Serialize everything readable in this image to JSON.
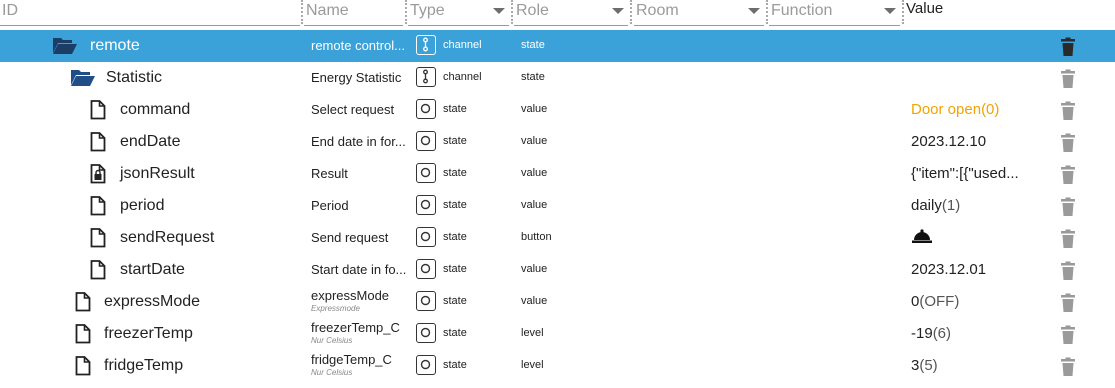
{
  "header": {
    "filters": [
      {
        "key": "id",
        "placeholder": "ID",
        "select": false
      },
      {
        "key": "name",
        "placeholder": "Name",
        "select": false
      },
      {
        "key": "type",
        "placeholder": "Type",
        "select": true
      },
      {
        "key": "role",
        "placeholder": "Role",
        "select": true
      },
      {
        "key": "room",
        "placeholder": "Room",
        "select": true
      },
      {
        "key": "function",
        "placeholder": "Function",
        "select": true
      }
    ],
    "value_label": "Value"
  },
  "rows": [
    {
      "id": "remote",
      "kind": "folder-open",
      "indent": 1,
      "name": "remote control...",
      "sub": "",
      "type_icon": "channel-icon",
      "type": "channel",
      "role": "state",
      "value": "",
      "state": "",
      "value_color": "",
      "selected": true
    },
    {
      "id": "Statistic",
      "kind": "folder-open",
      "indent": 2,
      "name": "Energy Statistic",
      "sub": "",
      "type_icon": "channel-icon",
      "type": "channel",
      "role": "state",
      "value": "",
      "state": "",
      "value_color": "",
      "selected": false
    },
    {
      "id": "command",
      "kind": "file",
      "indent": 3,
      "name": "Select request",
      "sub": "",
      "type_icon": "state-icon",
      "type": "state",
      "role": "value",
      "value": "Door open",
      "state": "(0)",
      "value_color": "#f0a400",
      "selected": false
    },
    {
      "id": "endDate",
      "kind": "file",
      "indent": 3,
      "name": "End date in for...",
      "sub": "",
      "type_icon": "state-icon",
      "type": "state",
      "role": "value",
      "value": "2023.12.10",
      "state": "",
      "value_color": "",
      "selected": false
    },
    {
      "id": "jsonResult",
      "kind": "file-lock",
      "indent": 3,
      "name": "Result",
      "sub": "",
      "type_icon": "state-icon",
      "type": "state",
      "role": "value",
      "value": "{\"item\":[{\"used...",
      "state": "",
      "value_color": "",
      "selected": false
    },
    {
      "id": "period",
      "kind": "file",
      "indent": 3,
      "name": "Period",
      "sub": "",
      "type_icon": "state-icon",
      "type": "state",
      "role": "value",
      "value": "daily",
      "state": "(1)",
      "value_color": "",
      "selected": false
    },
    {
      "id": "sendRequest",
      "kind": "file",
      "indent": 3,
      "name": "Send request",
      "sub": "",
      "type_icon": "state-icon",
      "type": "state",
      "role": "button",
      "value": "",
      "state": "",
      "value_color": "",
      "selected": false,
      "bell": true
    },
    {
      "id": "startDate",
      "kind": "file",
      "indent": 3,
      "name": "Start date in fo...",
      "sub": "",
      "type_icon": "state-icon",
      "type": "state",
      "role": "value",
      "value": "2023.12.01",
      "state": "",
      "value_color": "",
      "selected": false
    },
    {
      "id": "expressMode",
      "kind": "file",
      "indent": 2,
      "name": "expressMode",
      "sub": "Expressmode",
      "type_icon": "state-icon",
      "type": "state",
      "role": "value",
      "value": "0",
      "state": "(OFF)",
      "value_color": "",
      "selected": false
    },
    {
      "id": "freezerTemp",
      "kind": "file",
      "indent": 2,
      "name": "freezerTemp_C",
      "sub": "Nur Celsius",
      "type_icon": "state-icon",
      "type": "state",
      "role": "level",
      "value": "-19",
      "state": "(6)",
      "value_color": "",
      "selected": false
    },
    {
      "id": "fridgeTemp",
      "kind": "file",
      "indent": 2,
      "name": "fridgeTemp_C",
      "sub": "Nur Celsius",
      "type_icon": "state-icon",
      "type": "state",
      "role": "level",
      "value": "3",
      "state": "(5)",
      "value_color": "",
      "selected": false
    }
  ]
}
